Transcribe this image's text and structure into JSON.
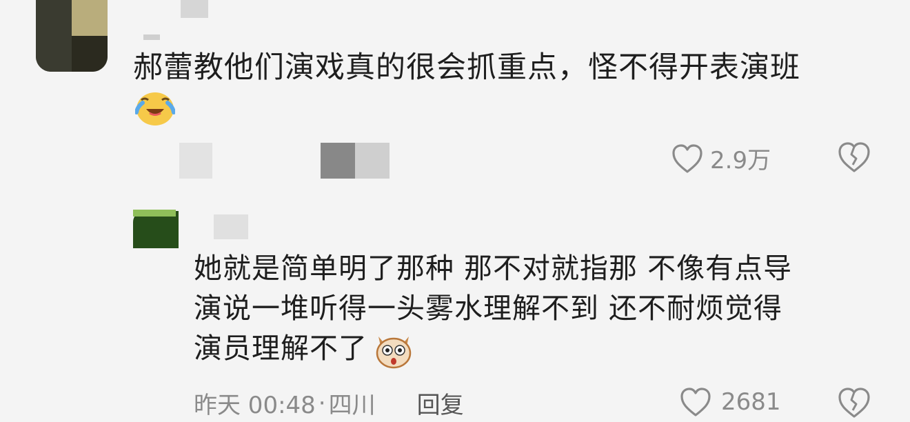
{
  "comment": {
    "text": "郝蕾教他们演戏真的很会抓重点，怪不得开表演班",
    "emoji": "laugh-cry-emoji",
    "likes": "2.9万"
  },
  "reply": {
    "lines": [
      "她就是简单明了那种 那不对就指那 不像有点导",
      "演说一堆听得一头雾水理解不到 还不耐烦觉得",
      "演员理解不了"
    ],
    "emoji": "shocked-dog-emoji",
    "time": "昨天 00:48",
    "separator": "·",
    "location": "四川",
    "reply_label": "回复",
    "likes": "2681"
  },
  "colors": {
    "background": "#f4f4f4",
    "text": "#1e1e1e",
    "meta": "#8a8a8a"
  }
}
